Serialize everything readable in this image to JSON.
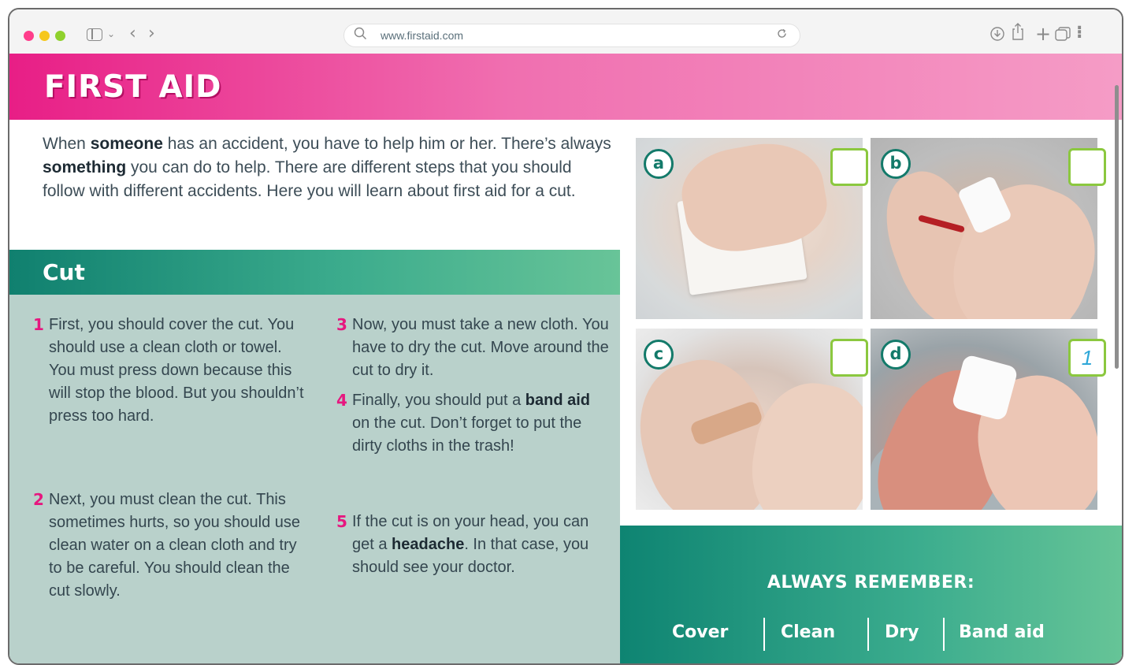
{
  "browser": {
    "url": "www.firstaid.com",
    "icons": [
      "sidebar-icon",
      "back-icon",
      "forward-icon",
      "search-icon",
      "reload-icon",
      "download-icon",
      "share-icon",
      "new-tab-icon",
      "tabs-icon",
      "more-icon"
    ]
  },
  "page": {
    "title": "FIRST AID",
    "intro": {
      "part1": "When ",
      "bold1": "someone",
      "part2": " has an accident, you have to help him or her. There’s always ",
      "bold2": "something",
      "part3": " you can do to help. There are different steps that you should follow with different accidents. Here you will learn about first aid for a cut."
    },
    "section_title": "Cut",
    "steps": [
      {
        "num": "1",
        "text": "First, you should cover the cut. You should use a clean cloth or towel. You must press down because this will stop the blood. But you shouldn’t press too hard."
      },
      {
        "num": "2",
        "text": "Next, you must clean the cut. This sometimes hurts, so you should use clean water on a clean cloth and try to be careful. You should clean the cut slowly."
      },
      {
        "num": "3",
        "text": "Now, you must take a new cloth. You have to dry the cut. Move around the cut to dry it."
      },
      {
        "num": "4",
        "pre": "Finally, you should put a ",
        "bold": "band aid",
        "post": " on the cut. Don’t forget to put the dirty cloths in the trash!"
      },
      {
        "num": "5",
        "pre": "If the cut is on your head, you can get a ",
        "bold": "headache",
        "post": ". In that case, you should see your doctor."
      }
    ],
    "photos": [
      {
        "letter": "a",
        "answer": ""
      },
      {
        "letter": "b",
        "answer": ""
      },
      {
        "letter": "c",
        "answer": ""
      },
      {
        "letter": "d",
        "answer": "1"
      }
    ],
    "remember": {
      "title": "ALWAYS REMEMBER:",
      "words": [
        "Cover",
        "Clean",
        "Dry",
        "Band aid"
      ]
    }
  },
  "colors": {
    "pink_accent": "#e6177f",
    "teal": "#137a6a",
    "answer_box_border": "#8bc83f",
    "answer_text": "#2ea7d8"
  }
}
